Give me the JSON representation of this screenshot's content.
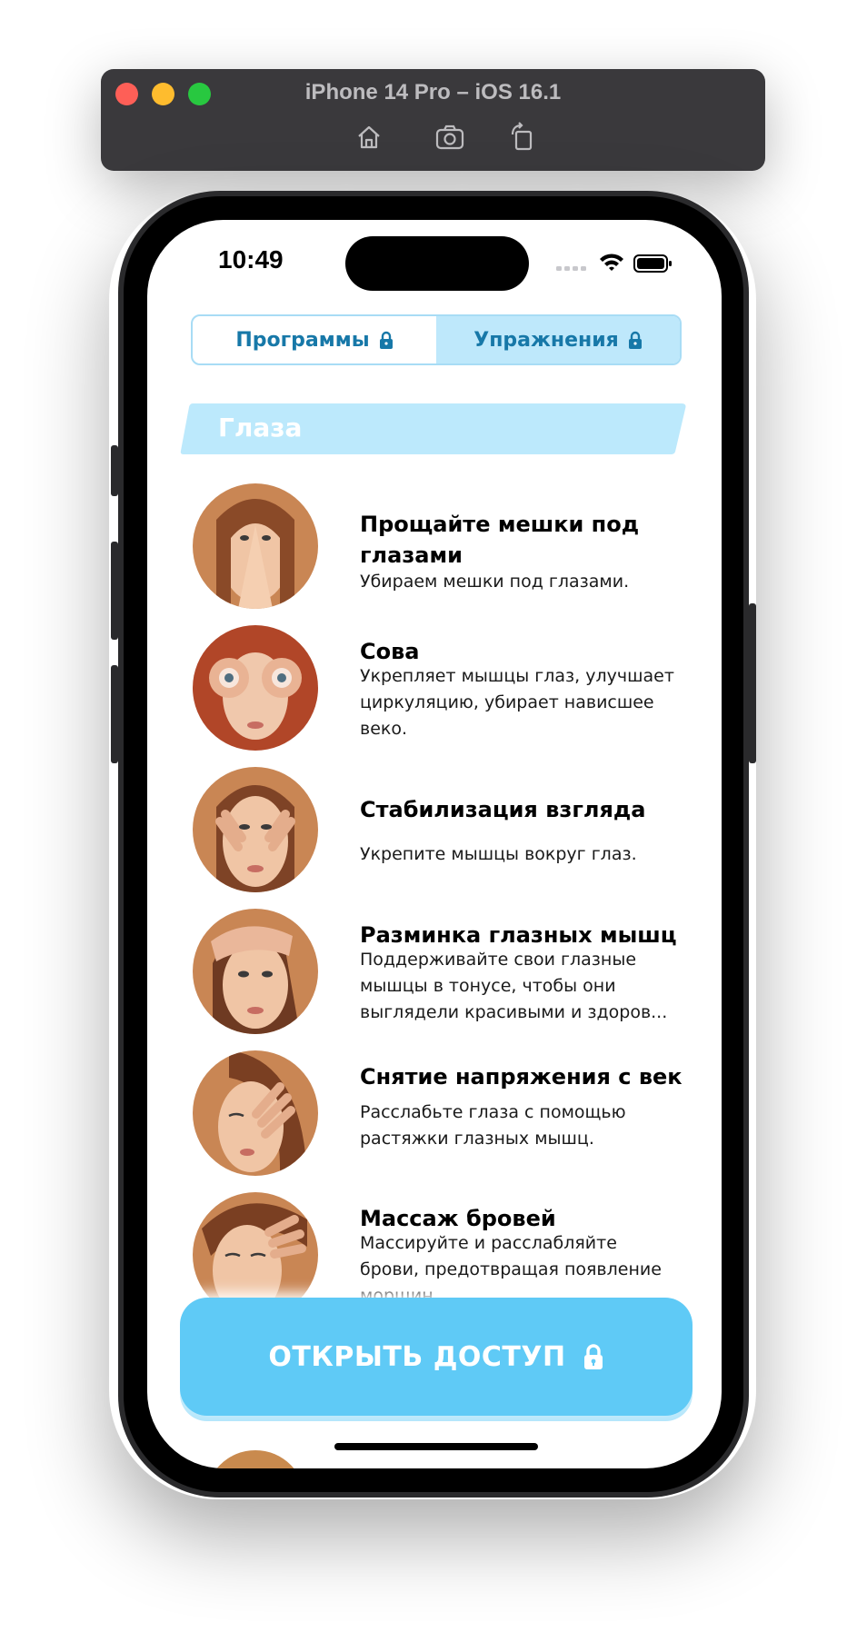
{
  "simulator": {
    "title": "iPhone 14 Pro – iOS 16.1",
    "tools": [
      "home-icon",
      "screenshot-icon",
      "rotate-icon"
    ]
  },
  "status_bar": {
    "time": "10:49"
  },
  "tabs": [
    {
      "label": "Программы",
      "locked": true,
      "active": false
    },
    {
      "label": "Упражнения",
      "locked": true,
      "active": true
    }
  ],
  "section": {
    "title": "Глаза"
  },
  "exercises": [
    {
      "title": "Прощайте мешки под глазами",
      "description": "Убираем мешки под глазами."
    },
    {
      "title": "Сова",
      "description": "Укрепляет мышцы глаз, улучшает циркуляцию, убирает нависшее веко."
    },
    {
      "title": "Стабилизация взгляда",
      "description": "Укрепите мышцы вокруг глаз."
    },
    {
      "title": "Разминка глазных мышц",
      "description": "Поддерживайте свои глазные мышцы в тонусе, чтобы они выглядели красивыми и здоров..."
    },
    {
      "title": "Снятие напряжения с век",
      "description": "Расслабьте глаза с помощью растяжки глазных мышц."
    },
    {
      "title": "Массаж бровей",
      "description": "Массируйте и расслабляйте брови, предотвращая появление морщин"
    }
  ],
  "cta": {
    "label": "ОТКРЫТЬ ДОСТУП"
  },
  "colors": {
    "accent": "#5fcaf6",
    "tab_active_bg": "#bee8fb",
    "tab_text": "#1778a8",
    "section_bg": "#bce9fc"
  }
}
